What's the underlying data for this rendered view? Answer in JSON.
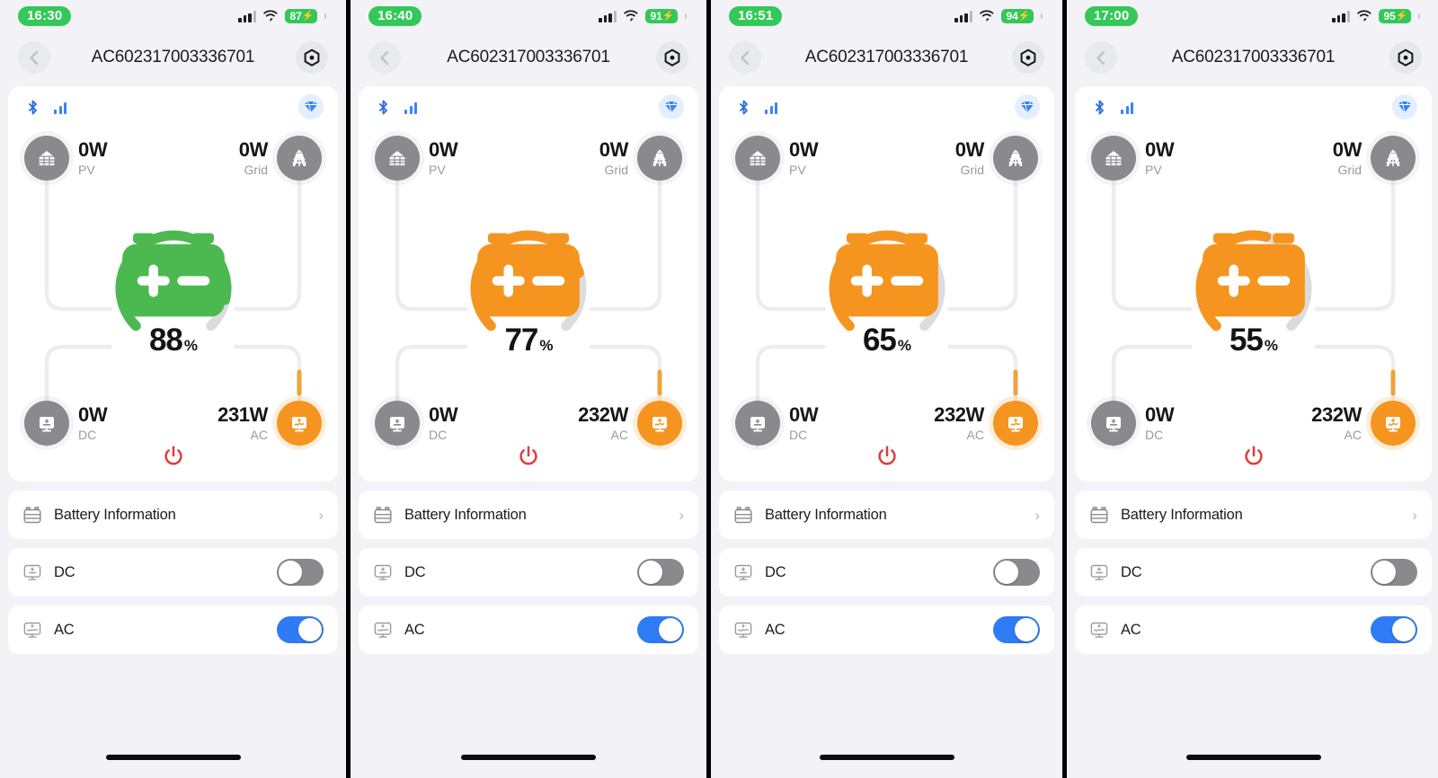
{
  "panels": [
    {
      "status": {
        "time": "16:30",
        "battery_level": "87",
        "charging": true,
        "wifi_icon": "wifi-icon",
        "signal_icon": "cellular-signal-icon"
      },
      "nav": {
        "back_icon": "chevron-left-icon",
        "title": "AC602317003336701",
        "settings_icon": "hex-nut-icon"
      },
      "card": {
        "bluetooth_icon": "bluetooth-icon",
        "signal_icon": "signal-bars-icon",
        "badge_icon": "gem-icon",
        "battery": {
          "percent": "88",
          "percent_value": 88,
          "unit": "%",
          "color": "#4cb950",
          "track_color": "#dcdcdf",
          "battery_icon": "battery-plus-minus-icon"
        },
        "nodes": [
          {
            "key": "pv",
            "icon": "solar-panel-icon",
            "value": "0W",
            "label": "PV",
            "color": "#8a8a8e"
          },
          {
            "key": "grid",
            "icon": "transmission-tower-icon",
            "value": "0W",
            "label": "Grid",
            "color": "#8a8a8e"
          },
          {
            "key": "dc",
            "icon": "dc-output-icon",
            "value": "0W",
            "label": "DC",
            "color": "#8a8a8e"
          },
          {
            "key": "ac",
            "icon": "ac-output-icon",
            "value": "231W",
            "label": "AC",
            "color": "#f59520"
          }
        ],
        "flow_active": {
          "pv": false,
          "grid": false,
          "dc": false,
          "ac": true
        },
        "power_icon": "power-button-icon",
        "power_color": "#e23b3b"
      },
      "rows": [
        {
          "icon": "battery-info-icon",
          "label": "Battery Information",
          "control": "chevron",
          "chevron": "›"
        },
        {
          "icon": "dc-output-icon",
          "label": "DC",
          "control": "toggle",
          "on": false
        },
        {
          "icon": "ac-output-icon",
          "label": "AC",
          "control": "toggle",
          "on": true
        }
      ]
    },
    {
      "status": {
        "time": "16:40",
        "battery_level": "91",
        "charging": true,
        "wifi_icon": "wifi-icon",
        "signal_icon": "cellular-signal-icon"
      },
      "nav": {
        "back_icon": "chevron-left-icon",
        "title": "AC602317003336701",
        "settings_icon": "hex-nut-icon"
      },
      "card": {
        "bluetooth_icon": "bluetooth-icon",
        "signal_icon": "signal-bars-icon",
        "badge_icon": "gem-icon",
        "battery": {
          "percent": "77",
          "percent_value": 77,
          "unit": "%",
          "color": "#f59520",
          "track_color": "#dcdcdf",
          "battery_icon": "battery-plus-minus-icon"
        },
        "nodes": [
          {
            "key": "pv",
            "icon": "solar-panel-icon",
            "value": "0W",
            "label": "PV",
            "color": "#8a8a8e"
          },
          {
            "key": "grid",
            "icon": "transmission-tower-icon",
            "value": "0W",
            "label": "Grid",
            "color": "#8a8a8e"
          },
          {
            "key": "dc",
            "icon": "dc-output-icon",
            "value": "0W",
            "label": "DC",
            "color": "#8a8a8e"
          },
          {
            "key": "ac",
            "icon": "ac-output-icon",
            "value": "232W",
            "label": "AC",
            "color": "#f59520"
          }
        ],
        "flow_active": {
          "pv": false,
          "grid": false,
          "dc": false,
          "ac": true
        },
        "power_icon": "power-button-icon",
        "power_color": "#e23b3b"
      },
      "rows": [
        {
          "icon": "battery-info-icon",
          "label": "Battery Information",
          "control": "chevron",
          "chevron": "›"
        },
        {
          "icon": "dc-output-icon",
          "label": "DC",
          "control": "toggle",
          "on": false
        },
        {
          "icon": "ac-output-icon",
          "label": "AC",
          "control": "toggle",
          "on": true
        }
      ]
    },
    {
      "status": {
        "time": "16:51",
        "battery_level": "94",
        "charging": true,
        "wifi_icon": "wifi-icon",
        "signal_icon": "cellular-signal-icon"
      },
      "nav": {
        "back_icon": "chevron-left-icon",
        "title": "AC602317003336701",
        "settings_icon": "hex-nut-icon"
      },
      "card": {
        "bluetooth_icon": "bluetooth-icon",
        "signal_icon": "signal-bars-icon",
        "badge_icon": "gem-icon",
        "battery": {
          "percent": "65",
          "percent_value": 65,
          "unit": "%",
          "color": "#f59520",
          "track_color": "#dcdcdf",
          "battery_icon": "battery-plus-minus-icon"
        },
        "nodes": [
          {
            "key": "pv",
            "icon": "solar-panel-icon",
            "value": "0W",
            "label": "PV",
            "color": "#8a8a8e"
          },
          {
            "key": "grid",
            "icon": "transmission-tower-icon",
            "value": "0W",
            "label": "Grid",
            "color": "#8a8a8e"
          },
          {
            "key": "dc",
            "icon": "dc-output-icon",
            "value": "0W",
            "label": "DC",
            "color": "#8a8a8e"
          },
          {
            "key": "ac",
            "icon": "ac-output-icon",
            "value": "232W",
            "label": "AC",
            "color": "#f59520"
          }
        ],
        "flow_active": {
          "pv": false,
          "grid": false,
          "dc": false,
          "ac": true
        },
        "power_icon": "power-button-icon",
        "power_color": "#e23b3b"
      },
      "rows": [
        {
          "icon": "battery-info-icon",
          "label": "Battery Information",
          "control": "chevron",
          "chevron": "›"
        },
        {
          "icon": "dc-output-icon",
          "label": "DC",
          "control": "toggle",
          "on": false
        },
        {
          "icon": "ac-output-icon",
          "label": "AC",
          "control": "toggle",
          "on": true
        }
      ]
    },
    {
      "status": {
        "time": "17:00",
        "battery_level": "95",
        "charging": true,
        "wifi_icon": "wifi-icon",
        "signal_icon": "cellular-signal-icon"
      },
      "nav": {
        "back_icon": "chevron-left-icon",
        "title": "AC602317003336701",
        "settings_icon": "hex-nut-icon"
      },
      "card": {
        "bluetooth_icon": "bluetooth-icon",
        "signal_icon": "signal-bars-icon",
        "badge_icon": "gem-icon",
        "battery": {
          "percent": "55",
          "percent_value": 55,
          "unit": "%",
          "color": "#f59520",
          "track_color": "#dcdcdf",
          "battery_icon": "battery-plus-minus-icon"
        },
        "nodes": [
          {
            "key": "pv",
            "icon": "solar-panel-icon",
            "value": "0W",
            "label": "PV",
            "color": "#8a8a8e"
          },
          {
            "key": "grid",
            "icon": "transmission-tower-icon",
            "value": "0W",
            "label": "Grid",
            "color": "#8a8a8e"
          },
          {
            "key": "dc",
            "icon": "dc-output-icon",
            "value": "0W",
            "label": "DC",
            "color": "#8a8a8e"
          },
          {
            "key": "ac",
            "icon": "ac-output-icon",
            "value": "232W",
            "label": "AC",
            "color": "#f59520"
          }
        ],
        "flow_active": {
          "pv": false,
          "grid": false,
          "dc": false,
          "ac": true
        },
        "power_icon": "power-button-icon",
        "power_color": "#e23b3b"
      },
      "rows": [
        {
          "icon": "battery-info-icon",
          "label": "Battery Information",
          "control": "chevron",
          "chevron": "›"
        },
        {
          "icon": "dc-output-icon",
          "label": "DC",
          "control": "toggle",
          "on": false
        },
        {
          "icon": "ac-output-icon",
          "label": "AC",
          "control": "toggle",
          "on": true
        }
      ]
    }
  ]
}
